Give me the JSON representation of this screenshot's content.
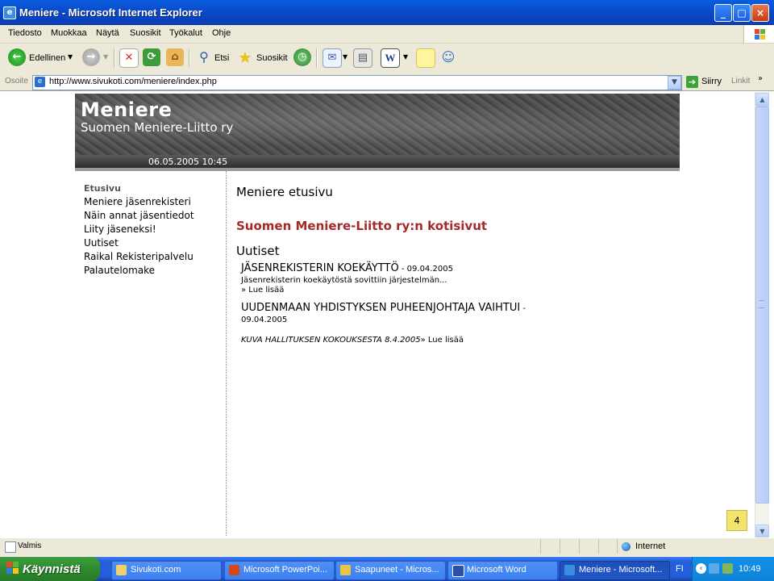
{
  "window": {
    "title": "Meniere - Microsoft Internet Explorer",
    "minimize": "_",
    "maximize": "□",
    "close": "×"
  },
  "menubar": {
    "items": [
      "Tiedosto",
      "Muokkaa",
      "Näytä",
      "Suosikit",
      "Työkalut",
      "Ohje"
    ]
  },
  "toolbar": {
    "back_label": "Edellinen",
    "search_label": "Etsi",
    "favorites_label": "Suosikit"
  },
  "address_bar": {
    "label": "Osoite",
    "url": "http://www.sivukoti.com/meniere/index.php",
    "go_label": "Siirry",
    "links_label": "Linkit"
  },
  "site": {
    "title": "Meniere",
    "subtitle": "Suomen Meniere-Liitto ry",
    "datetime": "06.05.2005 10:45",
    "nav": [
      "Etusivu",
      "Meniere jäsenrekisteri",
      "Näin annat jäsentiedot",
      "Liity jäseneksi!",
      "Uutiset",
      "Raikal Rekisteripalvelu",
      "Palautelomake"
    ],
    "page_heading": "Meniere etusivu",
    "site_heading": "Suomen Meniere-Liitto ry:n kotisivut",
    "news_heading": "Uutiset",
    "news": [
      {
        "title": "JÄSENREKISTERIN KOEKÄYTTÖ",
        "date": " - 09.04.2005",
        "excerpt": "Jäsenrekisterin koekäytöstä sovittiin järjestelmän...",
        "read_more": "» Lue lisää"
      },
      {
        "title": "UUDENMAAN YHDISTYKSEN PUHEENJOHTAJA VAIHTUI",
        "date_sep": " -",
        "date": "09.04.2005"
      },
      {
        "italic_text": "KUVA HALLITUKSEN KOKOUKSESTA 8.4.2005",
        "read_more": "» Lue lisää"
      }
    ]
  },
  "page_badge": "4",
  "statusbar": {
    "text": "Valmis",
    "zone": "Internet"
  },
  "taskbar": {
    "start_label": "Käynnistä",
    "tasks": [
      "Sivukoti.com",
      "Microsoft PowerPoi...",
      "Saapuneet - Micros...",
      "Microsoft Word",
      "Meniere - Microsoft..."
    ],
    "language": "FI",
    "time": "10:49"
  }
}
